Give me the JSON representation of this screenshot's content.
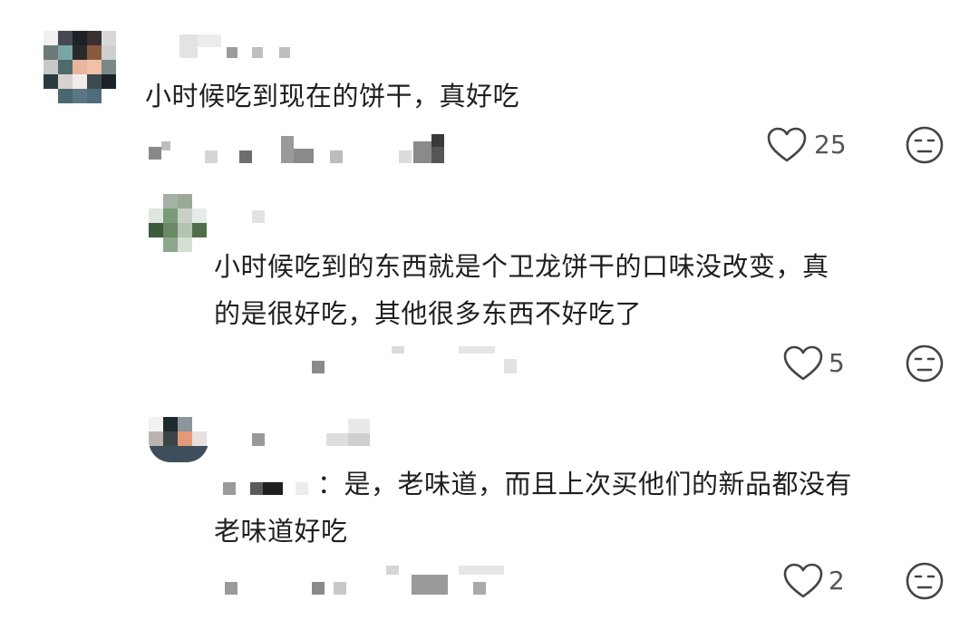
{
  "comments": [
    {
      "text": "小时候吃到现在的饼干，真好吃",
      "like_count": "25",
      "reply_icon": "meh-face-icon",
      "like_icon": "heart-outline-icon"
    },
    {
      "text_line1": "小时候吃到的东西就是个卫龙饼干的口味没改变，真",
      "text_line2": "的是很好吃，其他很多东西不好吃了",
      "like_count": "5",
      "reply_icon": "meh-face-icon",
      "like_icon": "heart-outline-icon"
    },
    {
      "text_line1": "：是，老味道，而且上次买他们的新品都没有",
      "text_line2": "老味道好吃",
      "like_count": "2",
      "reply_icon": "meh-face-icon",
      "like_icon": "heart-outline-icon"
    }
  ],
  "colors": {
    "text": "#1f1f1f",
    "count": "#555555",
    "icon": "#444444"
  }
}
